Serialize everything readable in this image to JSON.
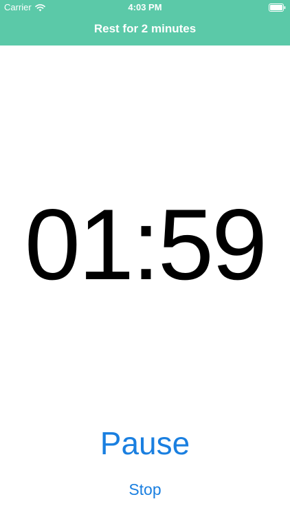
{
  "status_bar": {
    "carrier": "Carrier",
    "time": "4:03 PM",
    "wifi_icon": "wifi-icon",
    "battery_icon": "battery-icon"
  },
  "nav": {
    "title": "Rest for 2 minutes"
  },
  "timer": {
    "display": "01:59"
  },
  "controls": {
    "pause_label": "Pause",
    "stop_label": "Stop"
  },
  "colors": {
    "header_background": "#5bc9a8",
    "header_text": "#ffffff",
    "timer_text": "#000000",
    "action_text": "#1a7fe0",
    "background": "#ffffff"
  }
}
